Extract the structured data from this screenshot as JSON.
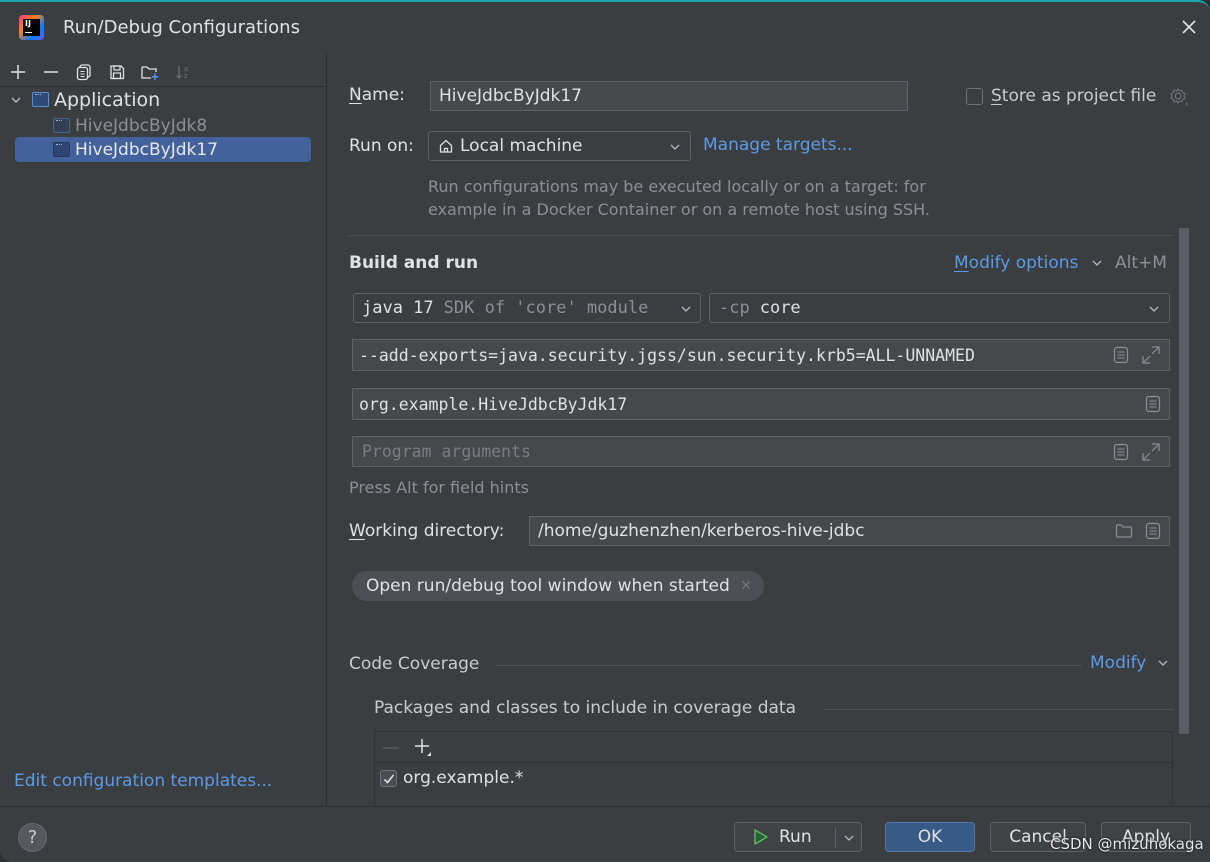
{
  "window": {
    "title": "Run/Debug Configurations",
    "app_icon": "intellij-idea-logo",
    "logo_text": "IJ"
  },
  "left_toolbar": {
    "icons": [
      "add-icon",
      "remove-icon",
      "copy-icon",
      "save-icon",
      "new-folder-icon",
      "sort-icon"
    ]
  },
  "tree": {
    "group": {
      "label": "Application",
      "expanded": true
    },
    "items": [
      {
        "label": "HiveJdbcByJdk8",
        "selected": false
      },
      {
        "label": "HiveJdbcByJdk17",
        "selected": true
      }
    ]
  },
  "edit_templates_link": "Edit configuration templates...",
  "form": {
    "name_label_u": "N",
    "name_label_rest": "ame:",
    "name_value": "HiveJdbcByJdk17",
    "store_as_project_u": "S",
    "store_as_project_rest": "tore as project file",
    "store_as_project_checked": false,
    "run_on_label": "Run on:",
    "run_on_value": "Local machine",
    "manage_targets": "Manage targets...",
    "run_on_hint_line1": "Run configurations may be executed locally or on a target: for",
    "run_on_hint_line2": "example in a Docker Container or on a remote host using SSH."
  },
  "build_and_run": {
    "title": "Build and run",
    "modify_options_u": "M",
    "modify_options_rest": "odify options",
    "modify_shortcut": "Alt+M",
    "jdk_main": "java 17",
    "jdk_hint": "SDK of 'core' module",
    "cp_prefix": "-cp",
    "cp_value": "core",
    "vm_options": "--add-exports=java.security.jgss/sun.security.krb5=ALL-UNNAMED",
    "main_class": "org.example.HiveJdbcByJdk17",
    "program_args_placeholder": "Program arguments",
    "field_hint": "Press Alt for field hints",
    "working_dir_label_u": "W",
    "working_dir_label_rest": "orking directory:",
    "working_dir_value": "/home/guzhenzhen/kerberos-hive-jdbc",
    "chip": "Open run/debug tool window when started"
  },
  "code_coverage": {
    "title": "Code Coverage",
    "modify": "Modify",
    "packages_title": "Packages and classes to include in coverage data",
    "entries": [
      {
        "pattern": "org.example.*",
        "checked": true
      }
    ]
  },
  "footer": {
    "help": "?",
    "run": "Run",
    "ok": "OK",
    "cancel": "Cancel",
    "apply": "Apply",
    "watermark": "CSDN @mizuhokaga"
  },
  "colors": {
    "accent_link": "#5c9ae6",
    "selection": "#43629b",
    "ok_button": "#375a87",
    "run_icon": "#5fb865"
  }
}
